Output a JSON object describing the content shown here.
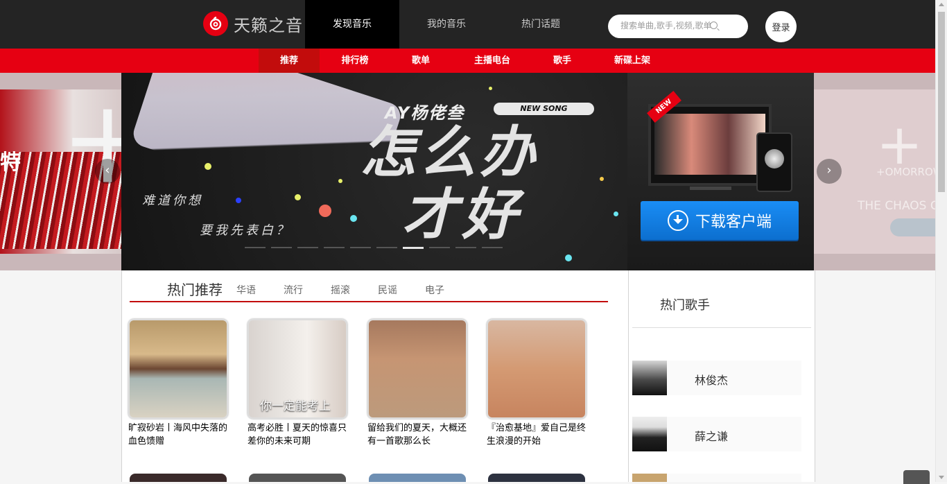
{
  "header": {
    "brand": "天籁之音",
    "nav": [
      {
        "label": "发现音乐",
        "active": true
      },
      {
        "label": "我的音乐",
        "active": false
      },
      {
        "label": "热门话题",
        "active": false
      }
    ],
    "search_placeholder": "搜索单曲,歌手,视频,歌单",
    "login_label": "登录"
  },
  "subnav": [
    "推荐",
    "排行榜",
    "歌单",
    "主播电台",
    "歌手",
    "新碟上架"
  ],
  "banner": {
    "artist": "AY杨佬叁",
    "new_song": "NEW SONG",
    "title_line1": "怎么办",
    "title_line2": "才好",
    "lyric_line1": "难道你想",
    "lyric_line2": "要我先表白？",
    "left_text": "特",
    "right_line1": "+OMORROW",
    "right_line2": "THE CHAOS CH",
    "new_tag": "NEW",
    "download_label": "下载客户端"
  },
  "hot": {
    "title": "热门推荐",
    "tags": [
      "华语",
      "流行",
      "摇滚",
      "民谣",
      "电子"
    ],
    "playlists": [
      {
        "title": "旷寂砂岩丨海风中失落的血色馈赠",
        "cover_text": ""
      },
      {
        "title": "高考必胜丨夏天的惊喜只差你的未来可期",
        "cover_text": "你一定能考上"
      },
      {
        "title": "留给我们的夏天，大概还有一首歌那么长",
        "cover_text": ""
      },
      {
        "title": "『治愈基地』爱自己是终生浪漫的开始",
        "cover_text": ""
      }
    ]
  },
  "singers": {
    "title": "热门歌手",
    "items": [
      {
        "name": "林俊杰"
      },
      {
        "name": "薛之谦"
      }
    ]
  },
  "colors": {
    "brand_red": "#e60012",
    "dark": "#242424",
    "download_blue": "#1a8df5"
  }
}
